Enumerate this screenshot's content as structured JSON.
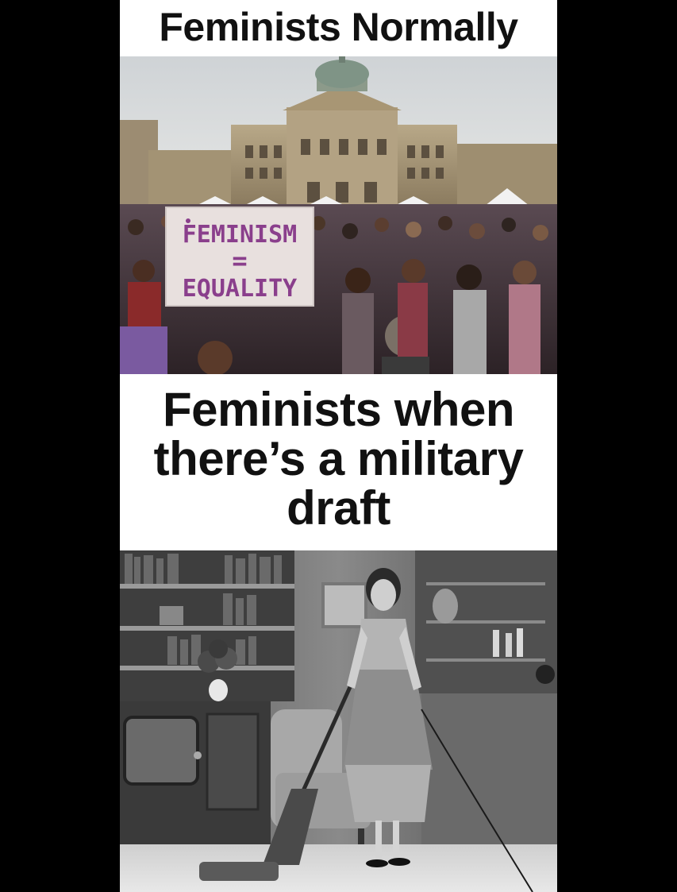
{
  "captions": {
    "top": "Feminists Normally",
    "middle_line1": "Feminists when",
    "middle_line2": "there’s a military",
    "middle_line3": "draft"
  },
  "sign": {
    "line1": "FEMINISM",
    "line2": "=",
    "line3": "EQUALITY"
  },
  "colors": {
    "background": "#000000",
    "caption_bg": "#ffffff",
    "caption_text": "#111111",
    "sign_text": "#8a3f8c"
  }
}
